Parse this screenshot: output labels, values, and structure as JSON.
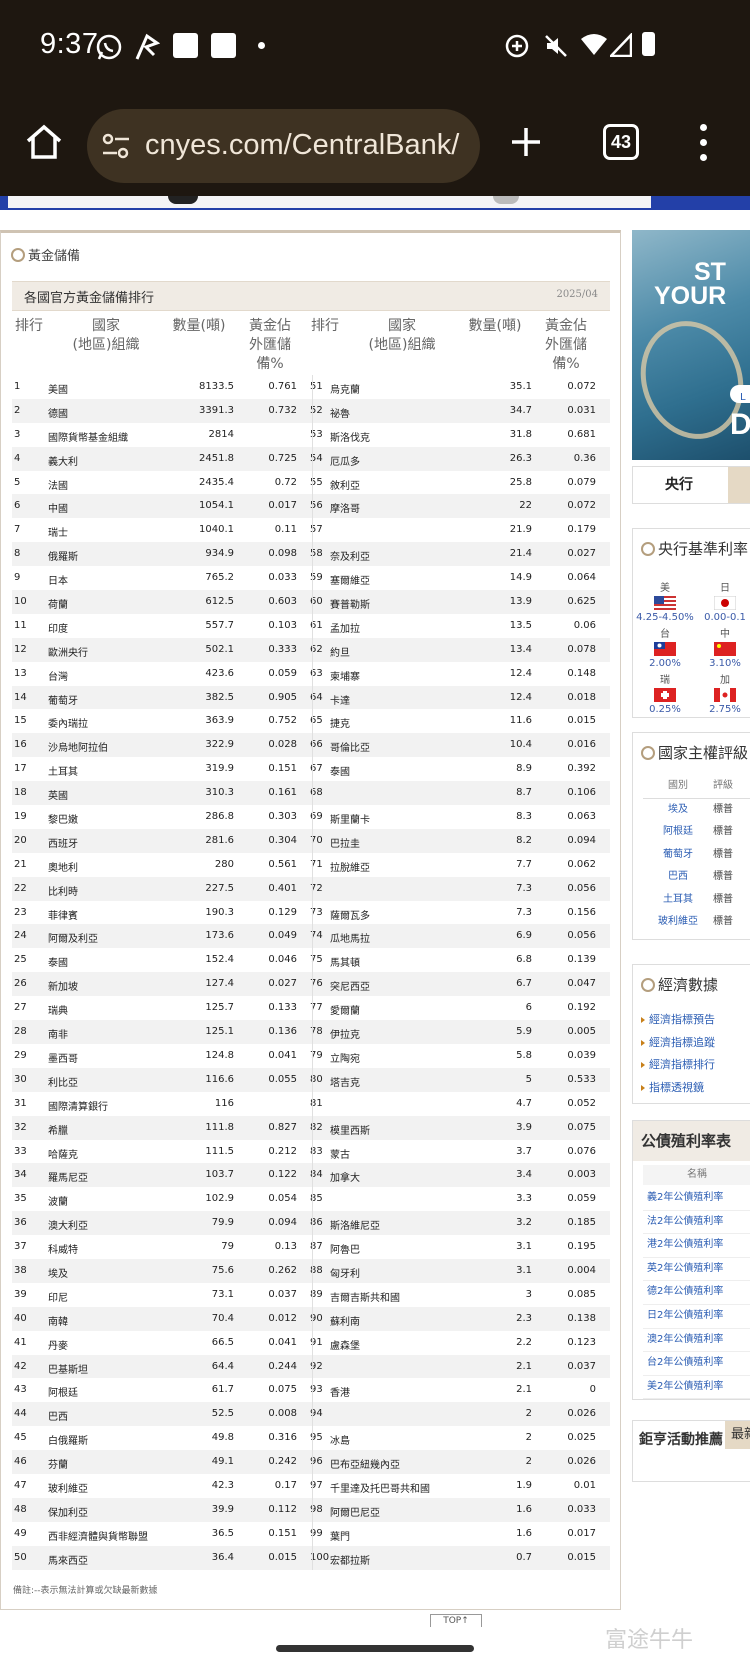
{
  "status": {
    "time": "9:37"
  },
  "browser": {
    "url": "cnyes.com/CentralBank/",
    "tab_count": "43"
  },
  "panel": {
    "section_title": "黃金儲備",
    "table_title": "各國官方黃金儲備排行",
    "table_date": "2025/04",
    "headers": {
      "rank": "排行",
      "country_l1": "國家",
      "country_l2": "(地區)組織",
      "amount": "數量(噸)",
      "pct_l1": "黃金佔",
      "pct_l2": "外匯儲",
      "pct_l3": "備%"
    },
    "note": "備註:--表示無法計算或欠缺最新數據",
    "top_button": "TOP↑",
    "rows": [
      {
        "r": "1",
        "n": "美國",
        "a": "8133.5",
        "p": "0.761",
        "r2": "51",
        "n2": "烏克蘭",
        "a2": "35.1",
        "p2": "0.072"
      },
      {
        "r": "2",
        "n": "德國",
        "a": "3391.3",
        "p": "0.732",
        "r2": "52",
        "n2": "祕魯",
        "a2": "34.7",
        "p2": "0.031"
      },
      {
        "r": "3",
        "n": "國際貨幣基金組織",
        "a": "2814",
        "p": "",
        "r2": "53",
        "n2": "斯洛伐克",
        "a2": "31.8",
        "p2": "0.681"
      },
      {
        "r": "4",
        "n": "義大利",
        "a": "2451.8",
        "p": "0.725",
        "r2": "54",
        "n2": "厄瓜多",
        "a2": "26.3",
        "p2": "0.36"
      },
      {
        "r": "5",
        "n": "法國",
        "a": "2435.4",
        "p": "0.72",
        "r2": "55",
        "n2": "敘利亞",
        "a2": "25.8",
        "p2": "0.079"
      },
      {
        "r": "6",
        "n": "中國",
        "a": "1054.1",
        "p": "0.017",
        "r2": "56",
        "n2": "摩洛哥",
        "a2": "22",
        "p2": "0.072"
      },
      {
        "r": "7",
        "n": "瑞士",
        "a": "1040.1",
        "p": "0.11",
        "r2": "57",
        "n2": "",
        "a2": "21.9",
        "p2": "0.179"
      },
      {
        "r": "8",
        "n": "俄羅斯",
        "a": "934.9",
        "p": "0.098",
        "r2": "58",
        "n2": "奈及利亞",
        "a2": "21.4",
        "p2": "0.027"
      },
      {
        "r": "9",
        "n": "日本",
        "a": "765.2",
        "p": "0.033",
        "r2": "59",
        "n2": "塞爾維亞",
        "a2": "14.9",
        "p2": "0.064"
      },
      {
        "r": "10",
        "n": "荷蘭",
        "a": "612.5",
        "p": "0.603",
        "r2": "60",
        "n2": "賽普勒斯",
        "a2": "13.9",
        "p2": "0.625"
      },
      {
        "r": "11",
        "n": "印度",
        "a": "557.7",
        "p": "0.103",
        "r2": "61",
        "n2": "孟加拉",
        "a2": "13.5",
        "p2": "0.06"
      },
      {
        "r": "12",
        "n": "歐洲央行",
        "a": "502.1",
        "p": "0.333",
        "r2": "62",
        "n2": "約旦",
        "a2": "13.4",
        "p2": "0.078"
      },
      {
        "r": "13",
        "n": "台灣",
        "a": "423.6",
        "p": "0.059",
        "r2": "63",
        "n2": "柬埔寨",
        "a2": "12.4",
        "p2": "0.148"
      },
      {
        "r": "14",
        "n": "葡萄牙",
        "a": "382.5",
        "p": "0.905",
        "r2": "64",
        "n2": "卡達",
        "a2": "12.4",
        "p2": "0.018"
      },
      {
        "r": "15",
        "n": "委內瑞拉",
        "a": "363.9",
        "p": "0.752",
        "r2": "65",
        "n2": "捷克",
        "a2": "11.6",
        "p2": "0.015"
      },
      {
        "r": "16",
        "n": "沙烏地阿拉伯",
        "a": "322.9",
        "p": "0.028",
        "r2": "66",
        "n2": "哥倫比亞",
        "a2": "10.4",
        "p2": "0.016"
      },
      {
        "r": "17",
        "n": "土耳其",
        "a": "319.9",
        "p": "0.151",
        "r2": "67",
        "n2": "泰國",
        "a2": "8.9",
        "p2": "0.392"
      },
      {
        "r": "18",
        "n": "英國",
        "a": "310.3",
        "p": "0.161",
        "r2": "68",
        "n2": "",
        "a2": "8.7",
        "p2": "0.106"
      },
      {
        "r": "19",
        "n": "黎巴嫩",
        "a": "286.8",
        "p": "0.303",
        "r2": "69",
        "n2": "斯里蘭卡",
        "a2": "8.3",
        "p2": "0.063"
      },
      {
        "r": "20",
        "n": "西班牙",
        "a": "281.6",
        "p": "0.304",
        "r2": "70",
        "n2": "巴拉圭",
        "a2": "8.2",
        "p2": "0.094"
      },
      {
        "r": "21",
        "n": "奧地利",
        "a": "280",
        "p": "0.561",
        "r2": "71",
        "n2": "拉脫維亞",
        "a2": "7.7",
        "p2": "0.062"
      },
      {
        "r": "22",
        "n": "比利時",
        "a": "227.5",
        "p": "0.401",
        "r2": "72",
        "n2": "",
        "a2": "7.3",
        "p2": "0.056"
      },
      {
        "r": "23",
        "n": "菲律賓",
        "a": "190.3",
        "p": "0.129",
        "r2": "73",
        "n2": "薩爾瓦多",
        "a2": "7.3",
        "p2": "0.156"
      },
      {
        "r": "24",
        "n": "阿爾及利亞",
        "a": "173.6",
        "p": "0.049",
        "r2": "74",
        "n2": "瓜地馬拉",
        "a2": "6.9",
        "p2": "0.056"
      },
      {
        "r": "25",
        "n": "泰國",
        "a": "152.4",
        "p": "0.046",
        "r2": "75",
        "n2": "馬其頓",
        "a2": "6.8",
        "p2": "0.139"
      },
      {
        "r": "26",
        "n": "新加坡",
        "a": "127.4",
        "p": "0.027",
        "r2": "76",
        "n2": "突尼西亞",
        "a2": "6.7",
        "p2": "0.047"
      },
      {
        "r": "27",
        "n": "瑞典",
        "a": "125.7",
        "p": "0.133",
        "r2": "77",
        "n2": "愛爾蘭",
        "a2": "6",
        "p2": "0.192"
      },
      {
        "r": "28",
        "n": "南非",
        "a": "125.1",
        "p": "0.136",
        "r2": "78",
        "n2": "伊拉克",
        "a2": "5.9",
        "p2": "0.005"
      },
      {
        "r": "29",
        "n": "墨西哥",
        "a": "124.8",
        "p": "0.041",
        "r2": "79",
        "n2": "立陶宛",
        "a2": "5.8",
        "p2": "0.039"
      },
      {
        "r": "30",
        "n": "利比亞",
        "a": "116.6",
        "p": "0.055",
        "r2": "80",
        "n2": "塔吉克",
        "a2": "5",
        "p2": "0.533"
      },
      {
        "r": "31",
        "n": "國際清算銀行",
        "a": "116",
        "p": "",
        "r2": "81",
        "n2": "",
        "a2": "4.7",
        "p2": "0.052"
      },
      {
        "r": "32",
        "n": "希臘",
        "a": "111.8",
        "p": "0.827",
        "r2": "82",
        "n2": "模里西斯",
        "a2": "3.9",
        "p2": "0.075"
      },
      {
        "r": "33",
        "n": "哈薩克",
        "a": "111.5",
        "p": "0.212",
        "r2": "83",
        "n2": "蒙古",
        "a2": "3.7",
        "p2": "0.076"
      },
      {
        "r": "34",
        "n": "羅馬尼亞",
        "a": "103.7",
        "p": "0.122",
        "r2": "84",
        "n2": "加拿大",
        "a2": "3.4",
        "p2": "0.003"
      },
      {
        "r": "35",
        "n": "波蘭",
        "a": "102.9",
        "p": "0.054",
        "r2": "85",
        "n2": "",
        "a2": "3.3",
        "p2": "0.059"
      },
      {
        "r": "36",
        "n": "澳大利亞",
        "a": "79.9",
        "p": "0.094",
        "r2": "86",
        "n2": "斯洛維尼亞",
        "a2": "3.2",
        "p2": "0.185"
      },
      {
        "r": "37",
        "n": "科威特",
        "a": "79",
        "p": "0.13",
        "r2": "87",
        "n2": "阿魯巴",
        "a2": "3.1",
        "p2": "0.195"
      },
      {
        "r": "38",
        "n": "埃及",
        "a": "75.6",
        "p": "0.262",
        "r2": "88",
        "n2": "匈牙利",
        "a2": "3.1",
        "p2": "0.004"
      },
      {
        "r": "39",
        "n": "印尼",
        "a": "73.1",
        "p": "0.037",
        "r2": "89",
        "n2": "吉爾吉斯共和國",
        "a2": "3",
        "p2": "0.085"
      },
      {
        "r": "40",
        "n": "南韓",
        "a": "70.4",
        "p": "0.012",
        "r2": "90",
        "n2": "蘇利南",
        "a2": "2.3",
        "p2": "0.138"
      },
      {
        "r": "41",
        "n": "丹麥",
        "a": "66.5",
        "p": "0.041",
        "r2": "91",
        "n2": "盧森堡",
        "a2": "2.2",
        "p2": "0.123"
      },
      {
        "r": "42",
        "n": "巴基斯坦",
        "a": "64.4",
        "p": "0.244",
        "r2": "92",
        "n2": "",
        "a2": "2.1",
        "p2": "0.037"
      },
      {
        "r": "43",
        "n": "阿根廷",
        "a": "61.7",
        "p": "0.075",
        "r2": "93",
        "n2": "香港",
        "a2": "2.1",
        "p2": "0"
      },
      {
        "r": "44",
        "n": "巴西",
        "a": "52.5",
        "p": "0.008",
        "r2": "94",
        "n2": "",
        "a2": "2",
        "p2": "0.026"
      },
      {
        "r": "45",
        "n": "白俄羅斯",
        "a": "49.8",
        "p": "0.316",
        "r2": "95",
        "n2": "冰島",
        "a2": "2",
        "p2": "0.025"
      },
      {
        "r": "46",
        "n": "芬蘭",
        "a": "49.1",
        "p": "0.242",
        "r2": "96",
        "n2": "巴布亞紐幾內亞",
        "a2": "2",
        "p2": "0.026"
      },
      {
        "r": "47",
        "n": "玻利維亞",
        "a": "42.3",
        "p": "0.17",
        "r2": "97",
        "n2": "千里達及托巴哥共和國",
        "a2": "1.9",
        "p2": "0.01"
      },
      {
        "r": "48",
        "n": "保加利亞",
        "a": "39.9",
        "p": "0.112",
        "r2": "98",
        "n2": "阿爾巴尼亞",
        "a2": "1.6",
        "p2": "0.033"
      },
      {
        "r": "49",
        "n": "西非經濟體與貨幣聯盟",
        "a": "36.5",
        "p": "0.151",
        "r2": "99",
        "n2": "葉門",
        "a2": "1.6",
        "p2": "0.017"
      },
      {
        "r": "50",
        "n": "馬來西亞",
        "a": "36.4",
        "p": "0.015",
        "r2": "100",
        "n2": "宏都拉斯",
        "a2": "0.7",
        "p2": "0.015"
      }
    ]
  },
  "sidebar": {
    "ad": {
      "line1": "ST",
      "line2": "YOUR",
      "btn": "L",
      "line3": "D"
    },
    "tab_active": "央行",
    "rates_title": "央行基準利率",
    "rates": [
      {
        "label": "美",
        "value": "4.25-4.50%"
      },
      {
        "label": "日",
        "value": "0.00-0.1"
      },
      {
        "label": "台",
        "value": "2.00%"
      },
      {
        "label": "中",
        "value": "3.10%"
      },
      {
        "label": "瑞",
        "value": "0.25%"
      },
      {
        "label": "加",
        "value": "2.75%"
      }
    ],
    "sovereign_title": "國家主權評級",
    "sovereign_headers": {
      "c1": "國別",
      "c2": "評級"
    },
    "sovereign": [
      {
        "country": "埃及",
        "agency": "標普"
      },
      {
        "country": "阿根廷",
        "agency": "標普"
      },
      {
        "country": "葡萄牙",
        "agency": "標普"
      },
      {
        "country": "巴西",
        "agency": "標普"
      },
      {
        "country": "土耳其",
        "agency": "標普"
      },
      {
        "country": "玻利維亞",
        "agency": "標普"
      }
    ],
    "econ_title": "經濟數據",
    "econ_links": [
      "經濟指標預告",
      "經濟指標追蹤",
      "經濟指標排行",
      "指標透視鏡"
    ],
    "bond_title": "公債殖利率表",
    "bond_header": "名稱",
    "bonds": [
      "義2年公債殖利率",
      "法2年公債殖利率",
      "港2年公債殖利率",
      "英2年公債殖利率",
      "德2年公債殖利率",
      "日2年公債殖利率",
      "澳2年公債殖利率",
      "台2年公債殖利率",
      "美2年公債殖利率"
    ],
    "promo_title": "鉅亨活動推薦",
    "promo_tab": "最新"
  },
  "watermark": "富途牛牛"
}
